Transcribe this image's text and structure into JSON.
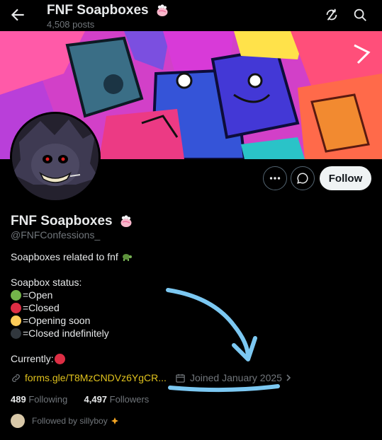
{
  "header": {
    "title": "FNF Soapboxes",
    "posts": "4,508 posts",
    "back_icon": "arrow-left-icon",
    "refresh_icon": "refresh-icon",
    "search_icon": "search-icon"
  },
  "profile": {
    "name": "FNF Soapboxes",
    "handle": "@FNFConfessions_",
    "follow_label": "Follow",
    "more_icon": "more-icon",
    "message_icon": "message-icon"
  },
  "bio": {
    "line1": "Soapboxes related to fnf",
    "status_title": "Soapbox status:",
    "statuses": [
      {
        "label": "=Open",
        "color": "#74b54a"
      },
      {
        "label": "=Closed",
        "color": "#dd2e44"
      },
      {
        "label": "=Opening soon",
        "color": "#fdcb58"
      },
      {
        "label": "=Closed indefinitely",
        "color": "#31373d"
      }
    ],
    "currently_label": "Currently:",
    "currently_color": "#dd2e44"
  },
  "meta": {
    "link": "forms.gle/T8MzCNDVz6YgCR...",
    "joined": "Joined January 2025"
  },
  "stats": {
    "following_count": "489",
    "following_label": "Following",
    "followers_count": "4,497",
    "followers_label": "Followers"
  },
  "followed_by": "Followed by sillyboy",
  "colors": {
    "accent_link": "#e0c21d",
    "annotation": "#7cc8f2"
  }
}
